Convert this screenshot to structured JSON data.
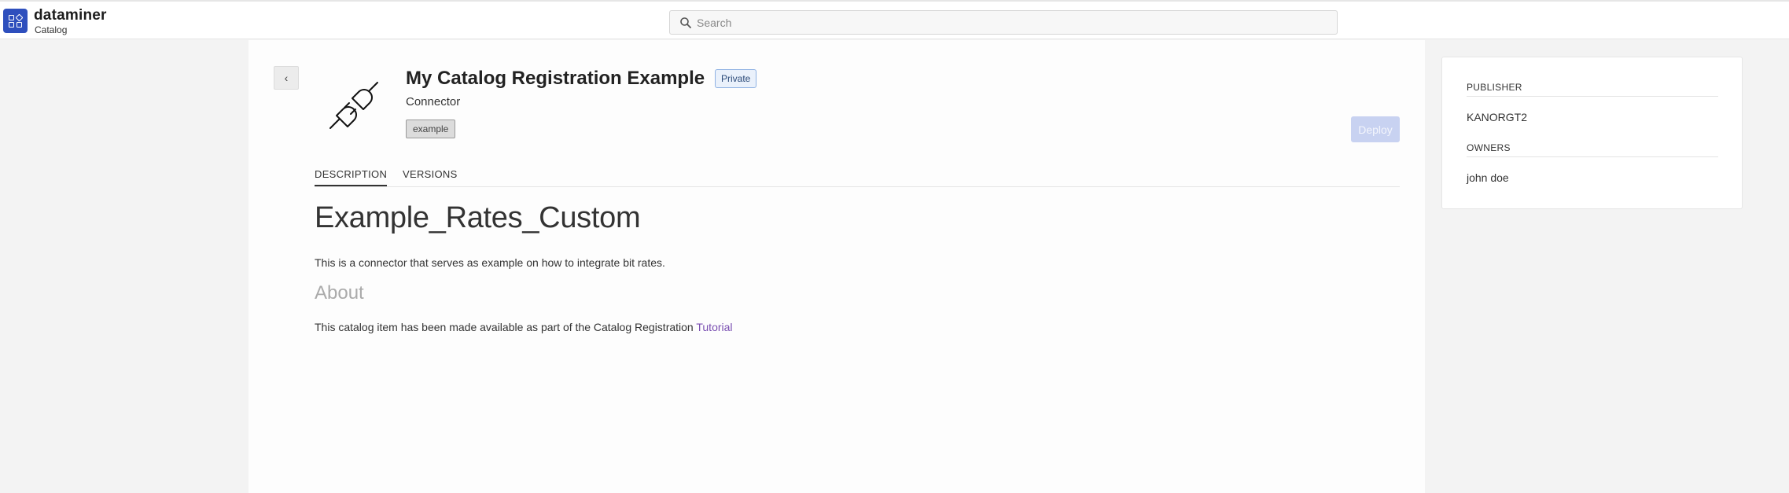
{
  "header": {
    "brand": "dataminer",
    "brand_sub": "Catalog",
    "search_placeholder": "Search",
    "icons": {
      "logo": "dataminer-logo-icon",
      "search": "search-icon"
    }
  },
  "item": {
    "title": "My Catalog Registration Example",
    "visibility_badge": "Private",
    "type": "Connector",
    "tags": [
      "example"
    ],
    "deploy_label": "Deploy",
    "back_icon": "chevron-left-icon",
    "item_icon": "plug-icon"
  },
  "tabs": [
    {
      "label": "DESCRIPTION",
      "active": true
    },
    {
      "label": "VERSIONS",
      "active": false
    }
  ],
  "description": {
    "heading": "Example_Rates_Custom",
    "intro": "This is a connector that serves as example on how to integrate bit rates.",
    "about_heading": "About",
    "about_text": "This catalog item has been made available as part of the Catalog Registration ",
    "about_link": "Tutorial"
  },
  "sidebar": {
    "publisher_label": "PUBLISHER",
    "publisher": "KANORGT2",
    "owners_label": "OWNERS",
    "owners": "john doe"
  },
  "colors": {
    "brand_blue": "#2e4fbd",
    "deploy_disabled": "#c8d2f1",
    "link_purple": "#7a4fb2",
    "badge_border": "#8fb2e3"
  }
}
